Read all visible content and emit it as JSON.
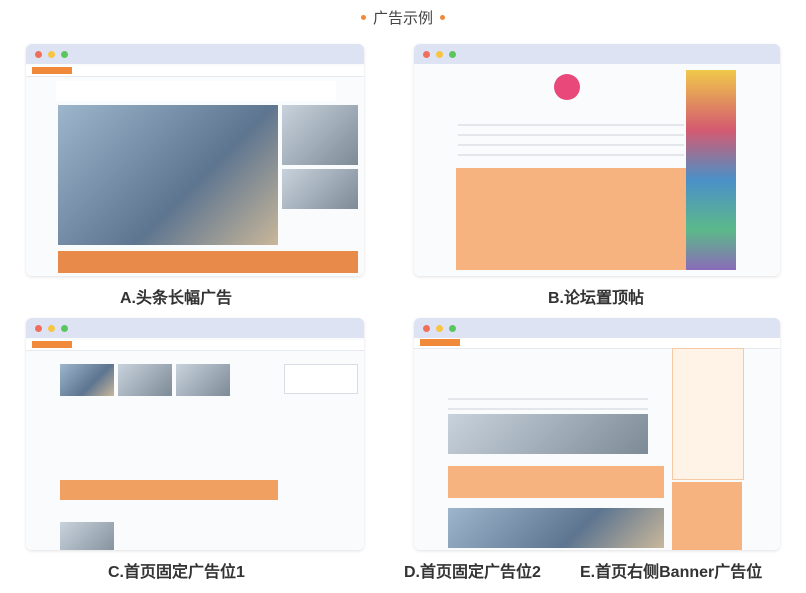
{
  "header": {
    "title": "广告示例"
  },
  "panels": [
    {
      "id": "A",
      "caption": "A.头条长幅广告"
    },
    {
      "id": "B",
      "caption": "B.论坛置顶帖"
    },
    {
      "id": "C",
      "caption": "C.首页固定广告位1"
    },
    {
      "id": "D",
      "caption": "D.首页固定广告位2"
    },
    {
      "id": "E",
      "caption": "E.首页右侧Banner广告位"
    }
  ],
  "colors": {
    "accent": "#f08a3a",
    "window_bar": "#dde3f3",
    "highlight_orange": "#f6b37f"
  }
}
